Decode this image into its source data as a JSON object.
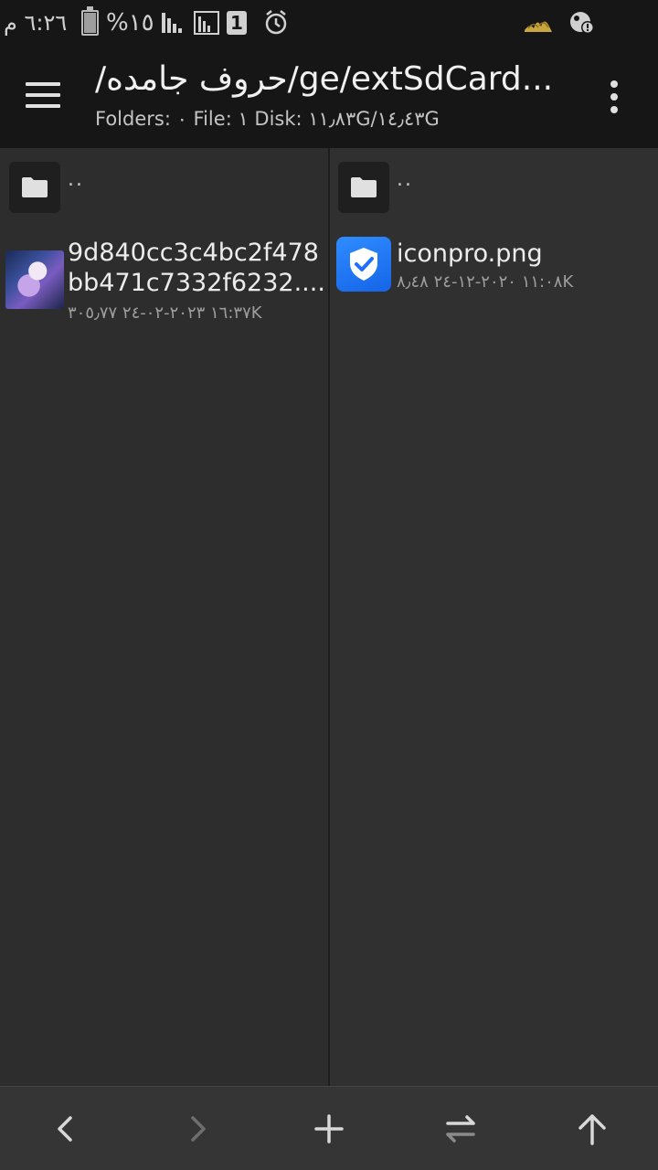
{
  "status_bar": {
    "time": "٦:٢٦ م",
    "battery_percent": "%١٥",
    "battery_level": 0.15,
    "sim_slot": "1",
    "icons": [
      "battery-icon",
      "signal-icon",
      "signal-icon",
      "sim-icon",
      "alarm-icon",
      "app-logo-icon",
      "notification-icon"
    ]
  },
  "toolbar": {
    "path": "/حروف جامده/ge/extSdCard...",
    "info": "Folders: ٠  File: ١  Disk: ١١٫٨٣G/١٤٫٤٣G"
  },
  "left_pane": {
    "up_label": "..",
    "files": [
      {
        "name_line1": "9d840cc3c4bc2f478",
        "name_line2": "bb471c7332f6232....",
        "meta": "١٦:٣٧ ٢٠٢٣-٠٢-٢٤   ٣٠٥٫٧٧K",
        "icon": "image-thumbnail"
      }
    ]
  },
  "right_pane": {
    "up_label": "..",
    "files": [
      {
        "name": "iconpro.png",
        "meta": "١١:٠٨ ٢٠٢٠-١٢-٢٤   ٨٫٤٨K",
        "icon": "shield-check-icon"
      }
    ]
  },
  "bottom_bar": {
    "buttons": [
      "back-icon",
      "forward-icon",
      "add-icon",
      "swap-icon",
      "up-icon"
    ]
  },
  "colors": {
    "background": "#2c2c2c",
    "toolbar": "#161616",
    "accent": "#1f6fff"
  }
}
